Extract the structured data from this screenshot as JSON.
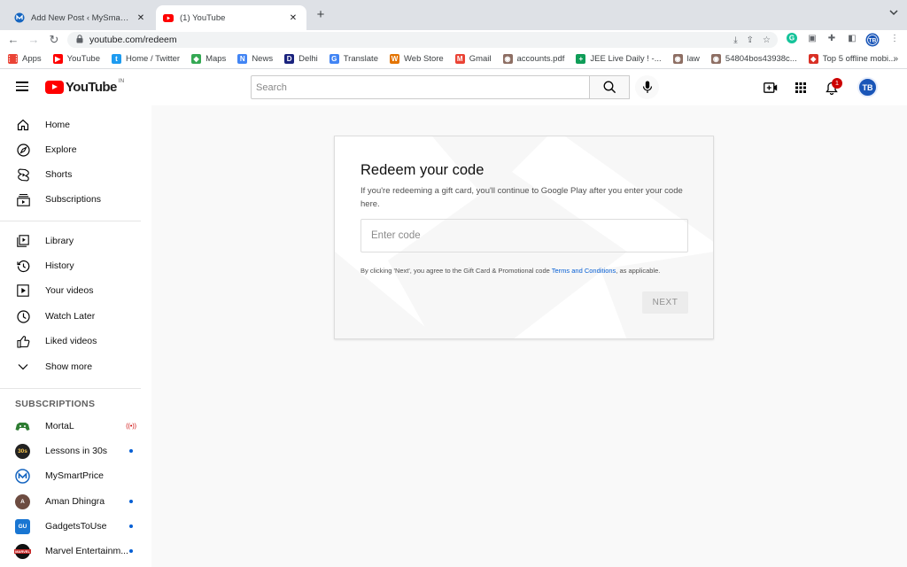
{
  "browser": {
    "tabs": [
      {
        "title": "Add New Post ‹ MySmartPrice",
        "active": false
      },
      {
        "title": "(1) YouTube",
        "active": true
      }
    ],
    "new_tab_symbol": "+",
    "url": "youtube.com/redeem",
    "bookmarks": [
      {
        "label": "Apps",
        "icon": "apps-grid-icon",
        "color": "#ea4335"
      },
      {
        "label": "YouTube",
        "icon": "youtube-icon",
        "color": "#ff0000"
      },
      {
        "label": "Home / Twitter",
        "icon": "twitter-icon",
        "color": "#1d9bf0"
      },
      {
        "label": "Maps",
        "icon": "maps-pin-icon",
        "color": "#34a853"
      },
      {
        "label": "News",
        "icon": "news-icon",
        "color": "#4285f4"
      },
      {
        "label": "Delhi",
        "icon": "delhi-icon",
        "color": "#1a237e"
      },
      {
        "label": "Translate",
        "icon": "translate-icon",
        "color": "#4285f4"
      },
      {
        "label": "Web Store",
        "icon": "webstore-icon",
        "color": "#e37400"
      },
      {
        "label": "Gmail",
        "icon": "gmail-icon",
        "color": "#ea4335"
      },
      {
        "label": "accounts.pdf",
        "icon": "pdf-icon",
        "color": "#8d6e63"
      },
      {
        "label": "JEE Live Daily ! -...",
        "icon": "sheets-icon",
        "color": "#0f9d58"
      },
      {
        "label": "law",
        "icon": "law-icon",
        "color": "#8d6e63"
      },
      {
        "label": "54804bos43938c...",
        "icon": "doc-icon",
        "color": "#8d6e63"
      },
      {
        "label": "Top 5 offline mobi...",
        "icon": "article-icon",
        "color": "#d93025"
      }
    ],
    "bookmarks_overflow": "»"
  },
  "youtube": {
    "logo_text": "YouTube",
    "country_code": "IN",
    "search_placeholder": "Search",
    "notification_count": "1",
    "avatar_initials": "TB"
  },
  "sidebar": {
    "main": [
      {
        "label": "Home",
        "icon": "home-icon"
      },
      {
        "label": "Explore",
        "icon": "compass-icon"
      },
      {
        "label": "Shorts",
        "icon": "shorts-icon"
      },
      {
        "label": "Subscriptions",
        "icon": "subscriptions-icon"
      }
    ],
    "library": [
      {
        "label": "Library",
        "icon": "library-icon"
      },
      {
        "label": "History",
        "icon": "history-icon"
      },
      {
        "label": "Your videos",
        "icon": "your-videos-icon"
      },
      {
        "label": "Watch Later",
        "icon": "clock-icon"
      },
      {
        "label": "Liked videos",
        "icon": "thumbs-up-icon"
      },
      {
        "label": "Show more",
        "icon": "chevron-down-icon"
      }
    ],
    "subscriptions_heading": "SUBSCRIPTIONS",
    "subscriptions": [
      {
        "label": "MortaL",
        "status": "live",
        "color": "#1b5e20",
        "avatar_text": "M"
      },
      {
        "label": "Lessons in 30s",
        "status": "new",
        "color": "#222222",
        "avatar_text": "30s"
      },
      {
        "label": "MySmartPrice",
        "status": "none",
        "color": "#1565c0",
        "avatar_text": "M"
      },
      {
        "label": "Aman Dhingra",
        "status": "new",
        "color": "#6d4c41",
        "avatar_text": "A"
      },
      {
        "label": "GadgetsToUse",
        "status": "new",
        "color": "#1976d2",
        "avatar_text": "GU"
      },
      {
        "label": "Marvel Entertainm...",
        "status": "new",
        "color": "#c62828",
        "avatar_text": "MARVEL"
      }
    ]
  },
  "redeem": {
    "title": "Redeem your code",
    "description": "If you're redeeming a gift card, you'll continue to Google Play after you enter your code here.",
    "code_placeholder": "Enter code",
    "legal_prefix": "By clicking 'Next', you agree to the Gift Card & Promotional code ",
    "legal_link": "Terms and Conditions",
    "legal_suffix": ", as applicable.",
    "next_label": "NEXT"
  }
}
